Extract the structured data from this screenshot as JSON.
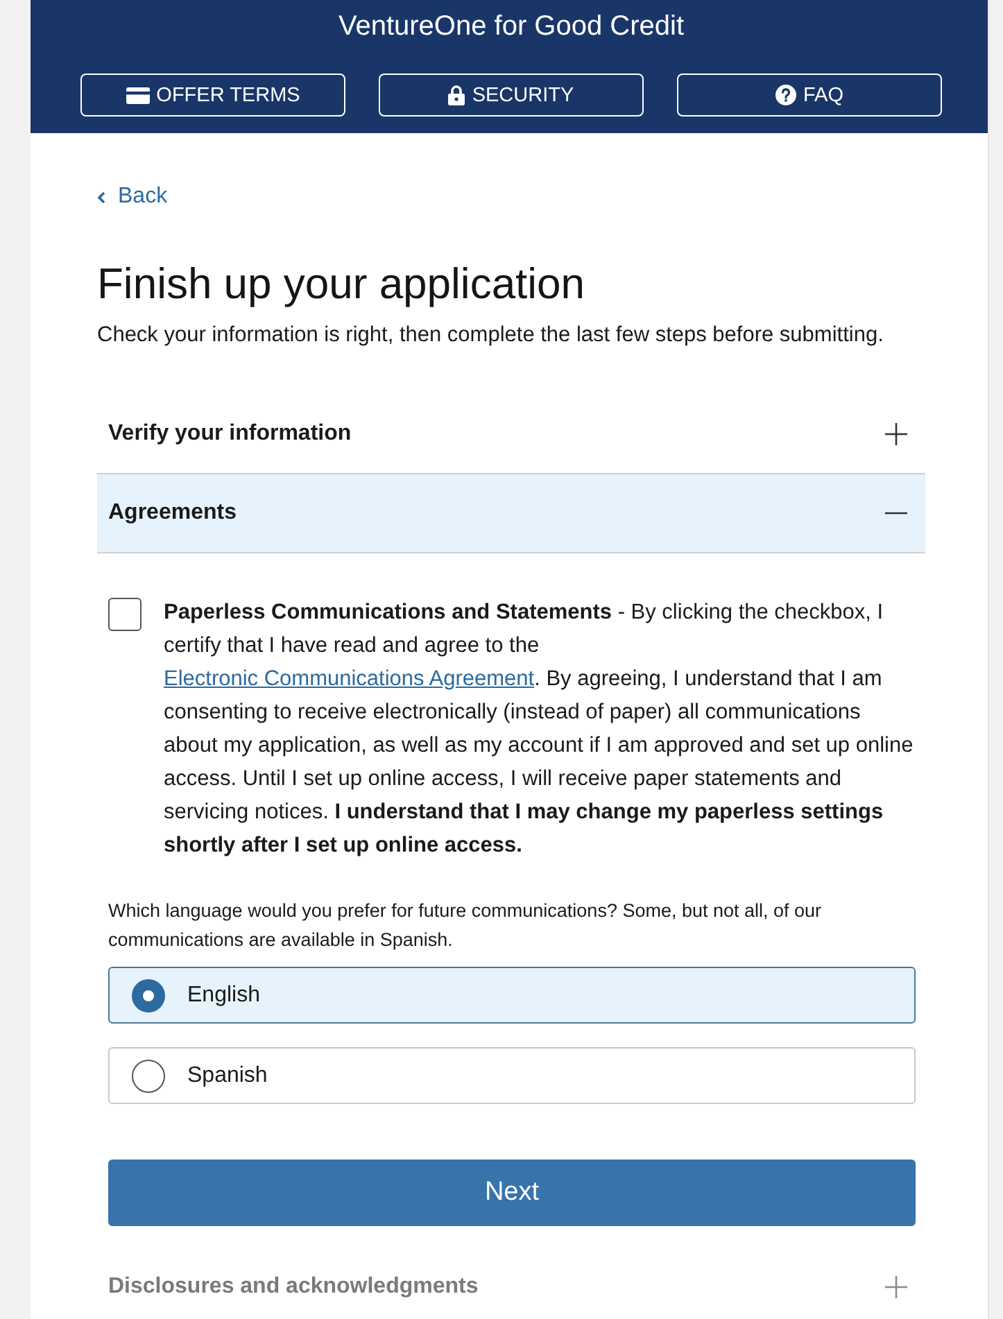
{
  "header": {
    "title": "VentureOne for Good Credit",
    "buttons": [
      {
        "label": "OFFER TERMS"
      },
      {
        "label": "SECURITY"
      },
      {
        "label": "FAQ"
      }
    ]
  },
  "back": {
    "label": "Back"
  },
  "heading": "Finish up your application",
  "subtitle": "Check your information is right, then complete the last few steps before submitting.",
  "sections": [
    {
      "title": "Verify your information",
      "expanded": false,
      "disabled": false
    },
    {
      "title": "Agreements",
      "expanded": true,
      "disabled": false,
      "content": {
        "consent": {
          "checked": false,
          "text_before": "**Paperless Communications and Statements** - By clicking the checkbox, I certify that I have read and agree to the ",
          "link": "Electronic Communications Agreement",
          "text_after": ". By agreeing, I understand that I am consenting to receive electronically (instead of paper) all communications about my application, as well as my account if I am approved and set up online access. Until I set up online access, I will receive paper statements and servicing notices. **I understand that I may change my paperless settings shortly after I set up online access.**"
        },
        "language": {
          "question": "Which language would you prefer for future communications? Some, but not all, of our communications are available in Spanish.",
          "options": [
            {
              "label": "English",
              "selected": true
            },
            {
              "label": "Spanish",
              "selected": false
            }
          ]
        },
        "next_button": "Next"
      }
    },
    {
      "title": "Disclosures and acknowledgments",
      "expanded": false,
      "disabled": true
    }
  ]
}
